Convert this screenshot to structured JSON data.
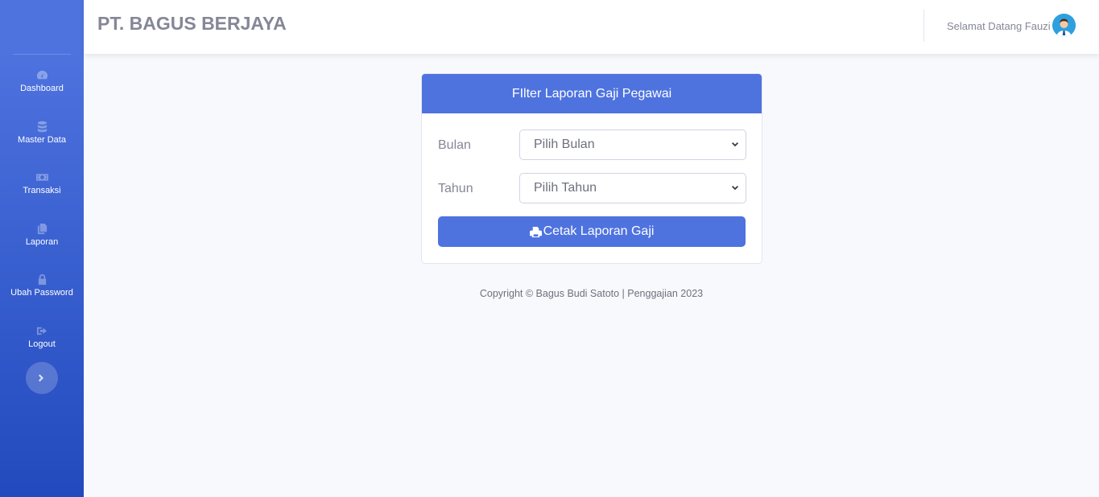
{
  "brand": "PT. BAGUS BERJAYA",
  "user": {
    "greeting": "Selamat Datang Fauzi"
  },
  "sidebar": {
    "items": [
      {
        "label": "Dashboard",
        "icon": "tachometer-icon"
      },
      {
        "label": "Master Data",
        "icon": "database-icon"
      },
      {
        "label": "Transaksi",
        "icon": "money-bill-icon"
      },
      {
        "label": "Laporan",
        "icon": "copy-icon"
      },
      {
        "label": "Ubah Password",
        "icon": "lock-icon"
      },
      {
        "label": "Logout",
        "icon": "sign-out-icon"
      }
    ]
  },
  "filter": {
    "title": "FIlter Laporan Gaji Pegawai",
    "bulan_label": "Bulan",
    "bulan_value": "Pilih Bulan",
    "tahun_label": "Tahun",
    "tahun_value": "Pilih Tahun",
    "button_label": "Cetak Laporan Gaji"
  },
  "footer": "Copyright © Bagus Budi Satoto | Penggajian 2023",
  "colors": {
    "primary": "#4e73df",
    "sidebar_bottom": "#224abe",
    "background": "#f8f9fc",
    "text_muted": "#858796"
  }
}
